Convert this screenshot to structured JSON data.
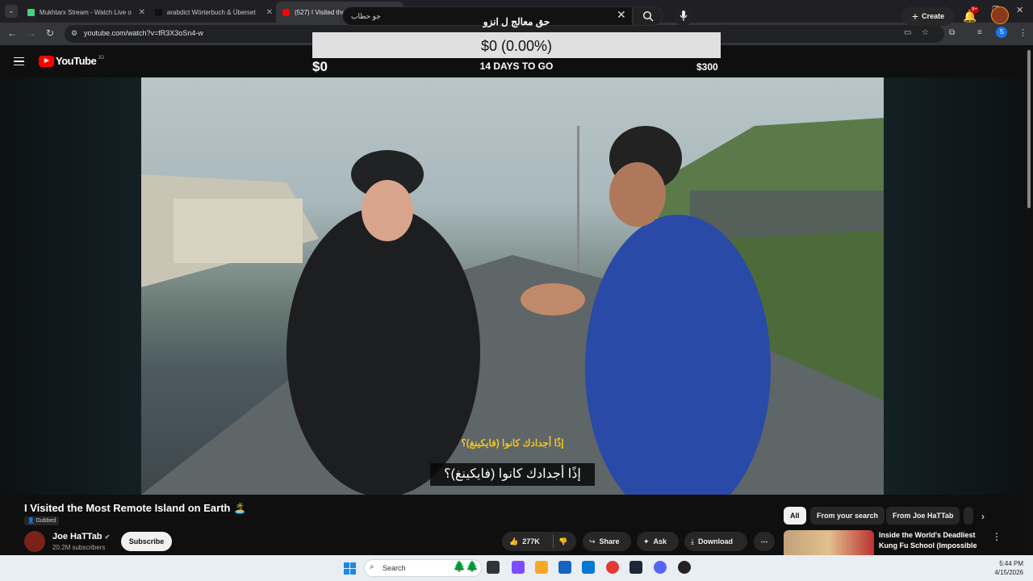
{
  "browser": {
    "tabs": [
      {
        "label": "Mukhtarx Stream - Watch Live o",
        "active": false
      },
      {
        "label": "arabdict Wörterbuch & Überset",
        "active": false
      },
      {
        "label": "(527) I Visited the Most Remo",
        "active": true
      }
    ],
    "url": "youtube.com/watch?v=fR3X3oSn4-w",
    "profile_initial": "S"
  },
  "overlay": {
    "title": "حق معالج ل انزو",
    "amount": "$0 (0.00%)",
    "start": "$0",
    "days_left": "14 DAYS TO GO",
    "goal": "$300",
    "progress_fraction": 0
  },
  "youtube": {
    "logo_text": "YouTube",
    "country_code": "JO",
    "search_value": "جو حطاب",
    "create_label": "Create",
    "notification_badge": "9+"
  },
  "video": {
    "subtitle_top": "إذًا أجدادك كانوا (فايكينغ)؟",
    "subtitle_main": "إذًا أجدادك كانوا (فايكينغ)؟",
    "title": "I Visited the Most Remote Island on Earth 🏝️",
    "dubbed_label": "Dubbed",
    "channel_name": "Joe HaTTab",
    "subscribers": "20.2M subscribers",
    "subscribe_label": "Subscribe",
    "likes": "277K",
    "share_label": "Share",
    "ask_label": "Ask",
    "download_label": "Download"
  },
  "sidebar": {
    "chips": [
      "All",
      "From your search",
      "From Joe HaTTab"
    ],
    "recommendation_title": "Inside the World's Deadliest Kung Fu School (Impossible ..."
  },
  "taskbar": {
    "search_placeholder": "Search",
    "time": "5:44 PM",
    "date": "4/15/2026"
  }
}
